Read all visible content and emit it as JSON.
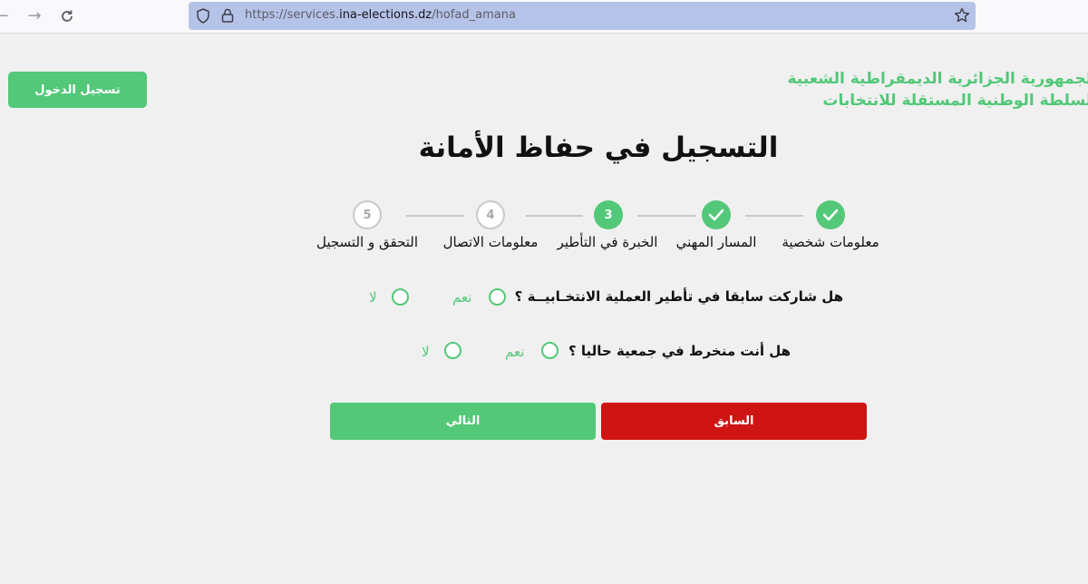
{
  "browser": {
    "url_prefix": "https://services.",
    "url_host": "ina-elections.dz",
    "url_path": "/hofad_amana"
  },
  "header": {
    "org_line_1": "الجمهورية الجزائرية الديمقراطية الشعبية",
    "org_line_2": "السلطة الوطنية المستقلة للانتخابات",
    "login_label": "تسجيل الدخول",
    "title": "التسجيل في حفاظ الأمانة"
  },
  "steps": [
    {
      "label": "معلومات شخصية",
      "state": "done",
      "number": ""
    },
    {
      "label": "المسار المهني",
      "state": "done",
      "number": ""
    },
    {
      "label": "الخبرة في التأطير",
      "state": "active",
      "number": "3"
    },
    {
      "label": "معلومات الاتصال",
      "state": "pending",
      "number": "4"
    },
    {
      "label": "التحقق و التسجيل",
      "state": "pending",
      "number": "5"
    }
  ],
  "questions": [
    {
      "text": "هل شاركت سابقا في تأطير العملية الانتخـابيــة ؟",
      "yes": "نعم",
      "no": "لا"
    },
    {
      "text": "هل أنت منخرط في جمعية حاليا ؟",
      "yes": "نعم",
      "no": "لا"
    }
  ],
  "buttons": {
    "next": "التالي",
    "prev": "السابق"
  },
  "colors": {
    "accent": "#52c878",
    "danger": "#cf1414",
    "pending": "#c9c9c9"
  }
}
